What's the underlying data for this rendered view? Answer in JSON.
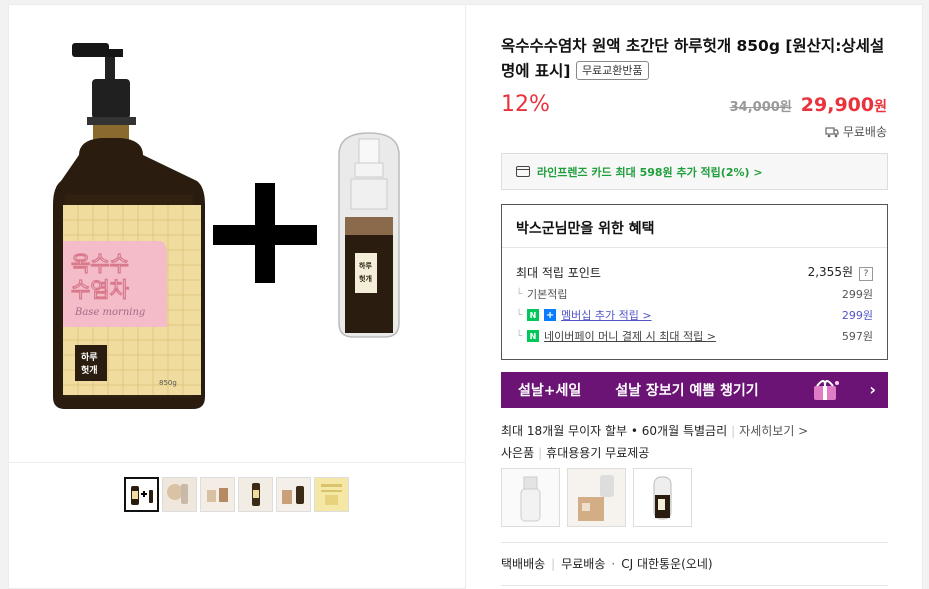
{
  "product": {
    "title": "옥수수수염차 원액 초간단 하루헛개 850g [원산지:상세설명에 표시]",
    "badge": "무료교환반품",
    "discount": "12%",
    "original_price": "34,000원",
    "price": "29,900",
    "price_unit": "원",
    "shipping": "무료배송"
  },
  "image_text": {
    "label_line1": "옥수수",
    "label_line2": "수염차",
    "label_sub": "Base morning",
    "brand_line1": "하루",
    "brand_line2": "헛개",
    "volume": "850g"
  },
  "card_promo": "라인프렌즈 카드 최대 598원 추가 적립(2%) >",
  "benefit": {
    "title": "박스군님만을 위한 혜택",
    "max_points_label": "최대 적립 포인트",
    "max_points_value": "2,355원",
    "basic_label": "기본적립",
    "basic_value": "299원",
    "membership_label": "멤버십 추가 적립 >",
    "membership_value": "299원",
    "naverpay_label": "네이버페이 머니 결제 시 최대 적립 >",
    "naverpay_value": "597원"
  },
  "banner": {
    "text1": "설날+세일",
    "text2": "설날 장보기 예쁨 챙기기",
    "arrow": "›"
  },
  "installment": {
    "text": "최대 18개월 무이자 할부 • 60개월 특별금리",
    "more": "자세히보기 >"
  },
  "gift": {
    "label": "사은품",
    "text": "휴대용용기 무료제공"
  },
  "delivery": {
    "method": "택배배송",
    "free": "무료배송",
    "courier": "CJ 대한통운(오네)"
  },
  "colors": {
    "discount_red": "#e8323c",
    "banner_purple": "#6b1475",
    "naver_green": "#03c75a",
    "link_blue": "#5254c8"
  }
}
